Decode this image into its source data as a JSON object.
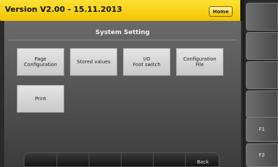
{
  "header": {
    "title": "Version V2.00 - 15.11.2013",
    "home_label": "Home"
  },
  "main": {
    "title": "System Setting",
    "tiles": [
      {
        "label": "Page\nConfiguration"
      },
      {
        "label": "Stored values"
      },
      {
        "label": "I/O\nFoot switch"
      },
      {
        "label": "Configuration\nFile"
      },
      {
        "label": "Print"
      }
    ]
  },
  "bottom_bar": {
    "back_label": "Back"
  },
  "side_panel": {
    "f1_label": "F1",
    "f2_label": "F2"
  },
  "colors": {
    "header_bg": "#f5cc00",
    "tile_bg": "#d8d8d8",
    "screen_bg": "#5a5a5a"
  }
}
